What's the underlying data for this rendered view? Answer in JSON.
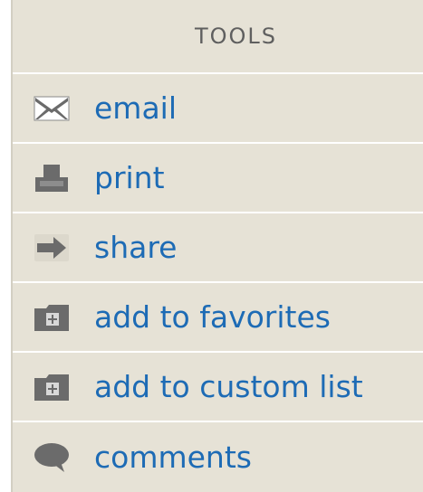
{
  "tools": {
    "title": "TOOLS",
    "items": [
      {
        "label": "email",
        "icon": "envelope-icon"
      },
      {
        "label": "print",
        "icon": "printer-icon"
      },
      {
        "label": "share",
        "icon": "arrow-right-icon"
      },
      {
        "label": "add to favorites",
        "icon": "folder-add-icon"
      },
      {
        "label": "add to custom list",
        "icon": "folder-add-icon"
      },
      {
        "label": "comments",
        "icon": "speech-bubble-icon"
      }
    ]
  },
  "colors": {
    "panel_bg": "#e6e2d6",
    "link": "#1d6bb5",
    "header_text": "#5f5f5f",
    "icon": "#6b6b6b",
    "divider": "#ffffff"
  }
}
